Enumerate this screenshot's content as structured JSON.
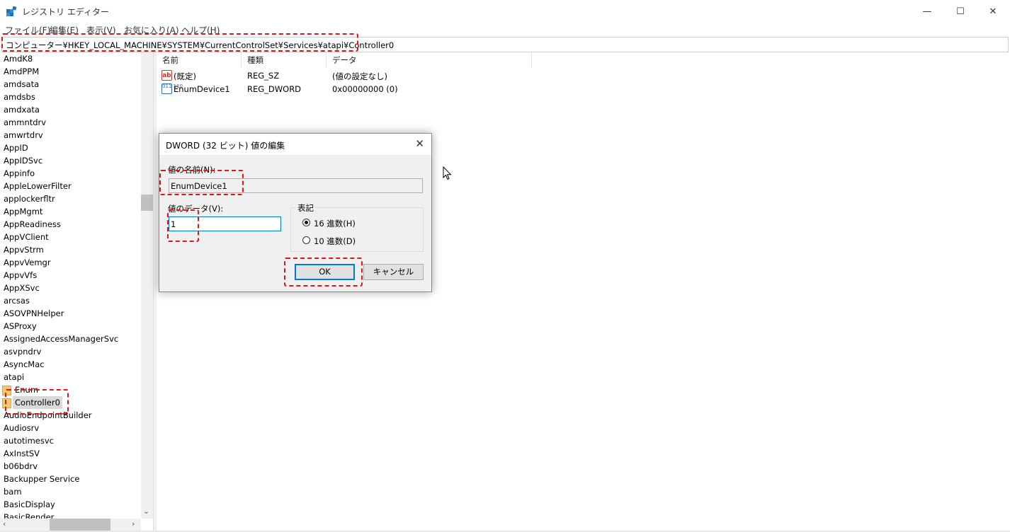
{
  "window": {
    "title": "レジストリ エディター",
    "minimize_glyph": "—",
    "maximize_glyph": "☐",
    "close_glyph": "✕"
  },
  "menu": [
    "ファイル(F)",
    "編集(E)",
    "表示(V)",
    "お気に入り(A)",
    "ヘルプ(H)"
  ],
  "address": "コンピューター¥HKEY_LOCAL_MACHINE¥SYSTEM¥CurrentControlSet¥Services¥atapi¥Controller0",
  "tree": {
    "items": [
      "AmdK8",
      "AmdPPM",
      "amdsata",
      "amdsbs",
      "amdxata",
      "ammntdrv",
      "amwrtdrv",
      "AppID",
      "AppIDSvc",
      "Appinfo",
      "AppleLowerFilter",
      "applockerfltr",
      "AppMgmt",
      "AppReadiness",
      "AppVClient",
      "AppvStrm",
      "AppvVemgr",
      "AppvVfs",
      "AppXSvc",
      "arcsas",
      "ASOVPNHelper",
      "ASProxy",
      "AssignedAccessManagerSvc",
      "asvpndrv",
      "AsyncMac",
      "atapi"
    ],
    "children": [
      "Enum",
      "Controller0"
    ],
    "after": [
      "AudioEndpointBuilder",
      "Audiosrv",
      "autotimesvc",
      "AxInstSV",
      "b06bdrv",
      "Backupper Service",
      "bam",
      "BasicDisplay",
      "BasicRender"
    ],
    "selected": "Controller0"
  },
  "list": {
    "columns": [
      "名前",
      "種類",
      "データ"
    ],
    "rows": [
      {
        "icon": "string-value-icon",
        "icon_text": "ab",
        "name": "(既定)",
        "type": "REG_SZ",
        "data": "(値の設定なし)"
      },
      {
        "icon": "binary-value-icon",
        "icon_text": "011 110",
        "name": "EnumDevice1",
        "type": "REG_DWORD",
        "data": "0x00000000 (0)"
      }
    ]
  },
  "dialog": {
    "title": "DWORD (32 ビット) 値の編集",
    "value_name_label": "値の名前(N):",
    "value_name": "EnumDevice1",
    "value_data_label": "値のデータ(V):",
    "value_data": "1",
    "base_group_label": "表記",
    "radio_hex": "16 進数(H)",
    "radio_dec": "10 進数(D)",
    "selected_base": "hex",
    "ok_label": "OK",
    "cancel_label": "キャンセル"
  },
  "colors": {
    "highlight": "#e0141a",
    "focus": "#0078d7"
  }
}
